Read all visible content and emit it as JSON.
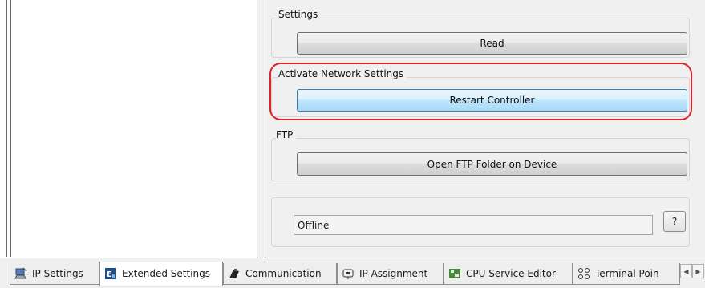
{
  "settings": {
    "title": "Settings",
    "read_label": "Read"
  },
  "network": {
    "title": "Activate Network Settings",
    "restart_label": "Restart Controller"
  },
  "ftp": {
    "title": "FTP",
    "open_label": "Open FTP Folder on Device"
  },
  "status": {
    "value": "Offline",
    "help_label": "?"
  },
  "tabs": [
    {
      "label": "IP Settings",
      "icon": "network-icon"
    },
    {
      "label": "Extended Settings",
      "icon": "extended-settings-icon"
    },
    {
      "label": "Communication",
      "icon": "communication-icon"
    },
    {
      "label": "IP Assignment",
      "icon": "ip-assignment-icon"
    },
    {
      "label": "CPU Service Editor",
      "icon": "cpu-service-icon"
    },
    {
      "label": "Terminal Poin",
      "icon": "terminal-points-icon"
    }
  ],
  "selected_tab": "Extended Settings",
  "colors": {
    "highlight": "#e0202a",
    "active_button": "#bee6fd"
  }
}
